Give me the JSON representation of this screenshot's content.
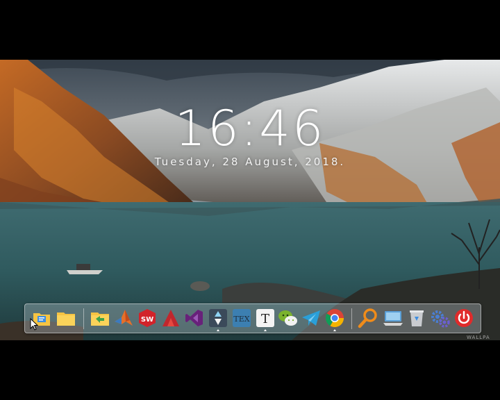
{
  "clock": {
    "time": "16:46",
    "date": "Tuesday, 28 August, 2018."
  },
  "dock": {
    "items": [
      {
        "name": "file-explorer",
        "icon": "folder-documents-icon",
        "running": false
      },
      {
        "name": "folder",
        "icon": "folder-icon",
        "running": false
      },
      {
        "name": "folder-green",
        "icon": "folder-green-icon",
        "running": false
      },
      {
        "name": "matlab",
        "icon": "matlab-icon",
        "running": false
      },
      {
        "name": "solidworks",
        "icon": "solidworks-icon",
        "running": false
      },
      {
        "name": "autocad",
        "icon": "autocad-icon",
        "running": false
      },
      {
        "name": "visual-studio",
        "icon": "visual-studio-icon",
        "running": false
      },
      {
        "name": "typora",
        "icon": "typora-icon",
        "running": true
      },
      {
        "name": "texstudio",
        "icon": "tex-icon",
        "running": false
      },
      {
        "name": "typora-text",
        "icon": "text-editor-icon",
        "running": true
      },
      {
        "name": "wechat",
        "icon": "wechat-icon",
        "running": false
      },
      {
        "name": "telegram",
        "icon": "telegram-icon",
        "running": false
      },
      {
        "name": "chrome",
        "icon": "chrome-icon",
        "running": true
      },
      {
        "name": "search",
        "icon": "search-icon",
        "running": false
      },
      {
        "name": "this-pc",
        "icon": "computer-icon",
        "running": false
      },
      {
        "name": "recycle-bin",
        "icon": "recycle-bin-icon",
        "running": false
      },
      {
        "name": "settings",
        "icon": "settings-gears-icon",
        "running": false
      },
      {
        "name": "power",
        "icon": "power-icon",
        "running": false
      }
    ],
    "icon_labels": {
      "solidworks": "SW",
      "tex": "TEX",
      "text": "T"
    }
  },
  "watermark": "WALLPA",
  "colors": {
    "folder": "#f6c443",
    "matlab": "#e5702a",
    "solidworks": "#d2232a",
    "autocad": "#c1272d",
    "visual_studio": "#68217a",
    "typora": "#3b4a5a",
    "tex": "#3c7fb1",
    "wechat": "#7bb32e",
    "telegram": "#2a9fd8",
    "search": "#f08c1a",
    "power": "#e02b2b"
  }
}
